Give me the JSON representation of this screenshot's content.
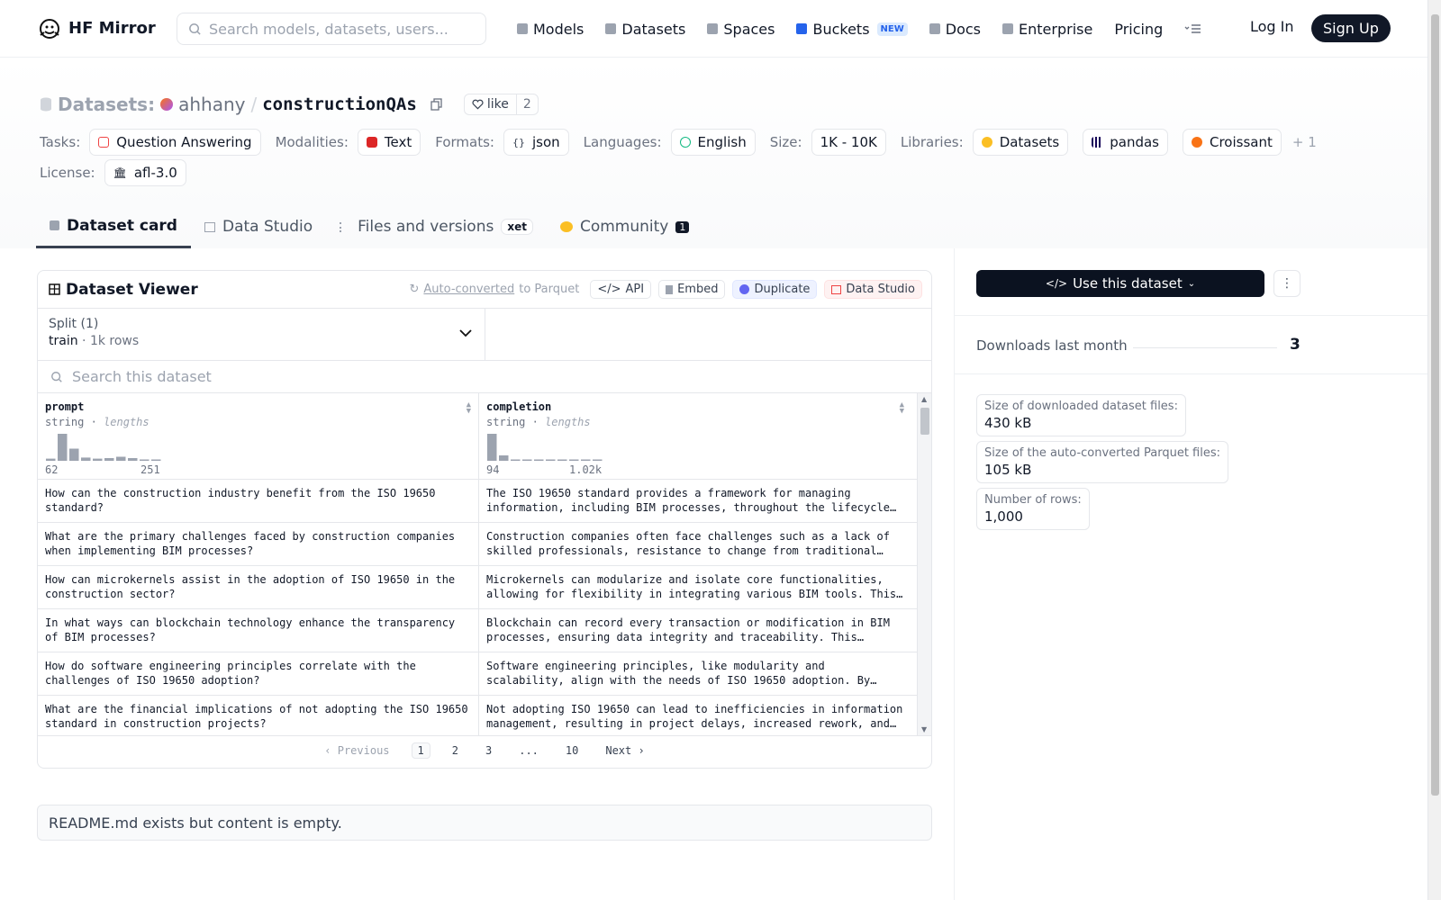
{
  "nav": {
    "brand": "HF Mirror",
    "search_placeholder": "Search models, datasets, users...",
    "links": [
      {
        "label": "Models",
        "icon": "cube-icon",
        "color": "#9ca3af"
      },
      {
        "label": "Datasets",
        "icon": "database-icon",
        "color": "#9ca3af"
      },
      {
        "label": "Spaces",
        "icon": "grid-icon",
        "color": "#9ca3af"
      },
      {
        "label": "Buckets",
        "icon": "bucket-icon",
        "color": "#2563eb",
        "badge": "NEW"
      },
      {
        "label": "Docs",
        "icon": "book-icon",
        "color": "#9ca3af"
      },
      {
        "label": "Enterprise",
        "icon": "enterprise-icon",
        "color": "#9ca3af"
      },
      {
        "label": "Pricing"
      }
    ],
    "login": "Log In",
    "signup": "Sign Up"
  },
  "header": {
    "type_label": "Datasets:",
    "owner": "ahhany",
    "separator": "/",
    "repo": "constructionQAs",
    "like_label": "like",
    "like_count": "2"
  },
  "tags": {
    "tasks_label": "Tasks:",
    "tasks": [
      "Question Answering"
    ],
    "modalities_label": "Modalities:",
    "modalities": [
      "Text"
    ],
    "formats_label": "Formats:",
    "formats": [
      "json"
    ],
    "languages_label": "Languages:",
    "languages": [
      "English"
    ],
    "size_label": "Size:",
    "size": [
      "1K - 10K"
    ],
    "libraries_label": "Libraries:",
    "libraries": [
      "Datasets",
      "pandas",
      "Croissant"
    ],
    "libraries_more": "+ 1",
    "license_label": "License:",
    "license": [
      "afl-3.0"
    ]
  },
  "tabs": [
    {
      "label": "Dataset card",
      "active": true
    },
    {
      "label": "Data Studio"
    },
    {
      "label": "Files and versions",
      "badge": "xet"
    },
    {
      "label": "Community",
      "count": "1"
    }
  ],
  "viewer": {
    "title": "Dataset Viewer",
    "autoconv_link": "Auto-converted",
    "autoconv_rest": "to Parquet",
    "actions": [
      "API",
      "Embed",
      "Duplicate",
      "Data Studio"
    ],
    "split_label": "Split (1)",
    "split_name": "train",
    "split_rows": "1k rows",
    "split_sep": "·",
    "search_placeholder": "Search this dataset",
    "columns": [
      {
        "name": "prompt",
        "type": "string",
        "sep": "·",
        "stat": "lengths",
        "min": "62",
        "max": "251",
        "hist": [
          0.08,
          1.0,
          0.45,
          0.12,
          0.08,
          0.1,
          0.15,
          0.1,
          0.04,
          0.03
        ]
      },
      {
        "name": "completion",
        "type": "string",
        "sep": "·",
        "stat": "lengths",
        "min": "94",
        "max": "1.02k",
        "hist": [
          1.0,
          0.2,
          0.05,
          0.05,
          0.05,
          0.05,
          0.05,
          0.05,
          0.05,
          0.05
        ]
      }
    ],
    "rows": [
      [
        "How can the construction industry benefit from the ISO 19650 standard?",
        "The ISO 19650 standard provides a framework for managing information, including BIM processes, throughout the lifecycle of a built asset."
      ],
      [
        "What are the primary challenges faced by construction companies when implementing BIM processes?",
        "Construction companies often face challenges such as a lack of skilled professionals, resistance to change from traditional methods."
      ],
      [
        "How can microkernels assist in the adoption of ISO 19650 in the construction sector?",
        "Microkernels can modularize and isolate core functionalities, allowing for flexibility in integrating various BIM tools. This approach."
      ],
      [
        "In what ways can blockchain technology enhance the transparency of BIM processes?",
        "Blockchain can record every transaction or modification in BIM processes, ensuring data integrity and traceability. This transparency."
      ],
      [
        "How do software engineering principles correlate with the challenges of ISO 19650 adoption?",
        "Software engineering principles, like modularity and scalability, align with the needs of ISO 19650 adoption. By breaking down complex."
      ],
      [
        "What are the financial implications of not adopting the ISO 19650 standard in construction projects?",
        "Not adopting ISO 19650 can lead to inefficiencies in information management, resulting in project delays, increased rework, and costs."
      ]
    ],
    "pager": {
      "prev": "Previous",
      "pages": [
        "1",
        "2",
        "3",
        "...",
        "10"
      ],
      "current": "1",
      "next": "Next"
    }
  },
  "readme_note": "README.md exists but content is empty.",
  "sidebar": {
    "use_button": "Use this dataset",
    "downloads_label": "Downloads last month",
    "downloads_value": "3",
    "stats": [
      {
        "label": "Size of downloaded dataset files:",
        "value": "430 kB"
      },
      {
        "label": "Size of the auto-converted Parquet files:",
        "value": "105 kB"
      },
      {
        "label": "Number of rows:",
        "value": "1,000"
      }
    ]
  },
  "colors": {
    "hist_bar": "#9ca3af",
    "primary_dark": "#0b1220"
  }
}
